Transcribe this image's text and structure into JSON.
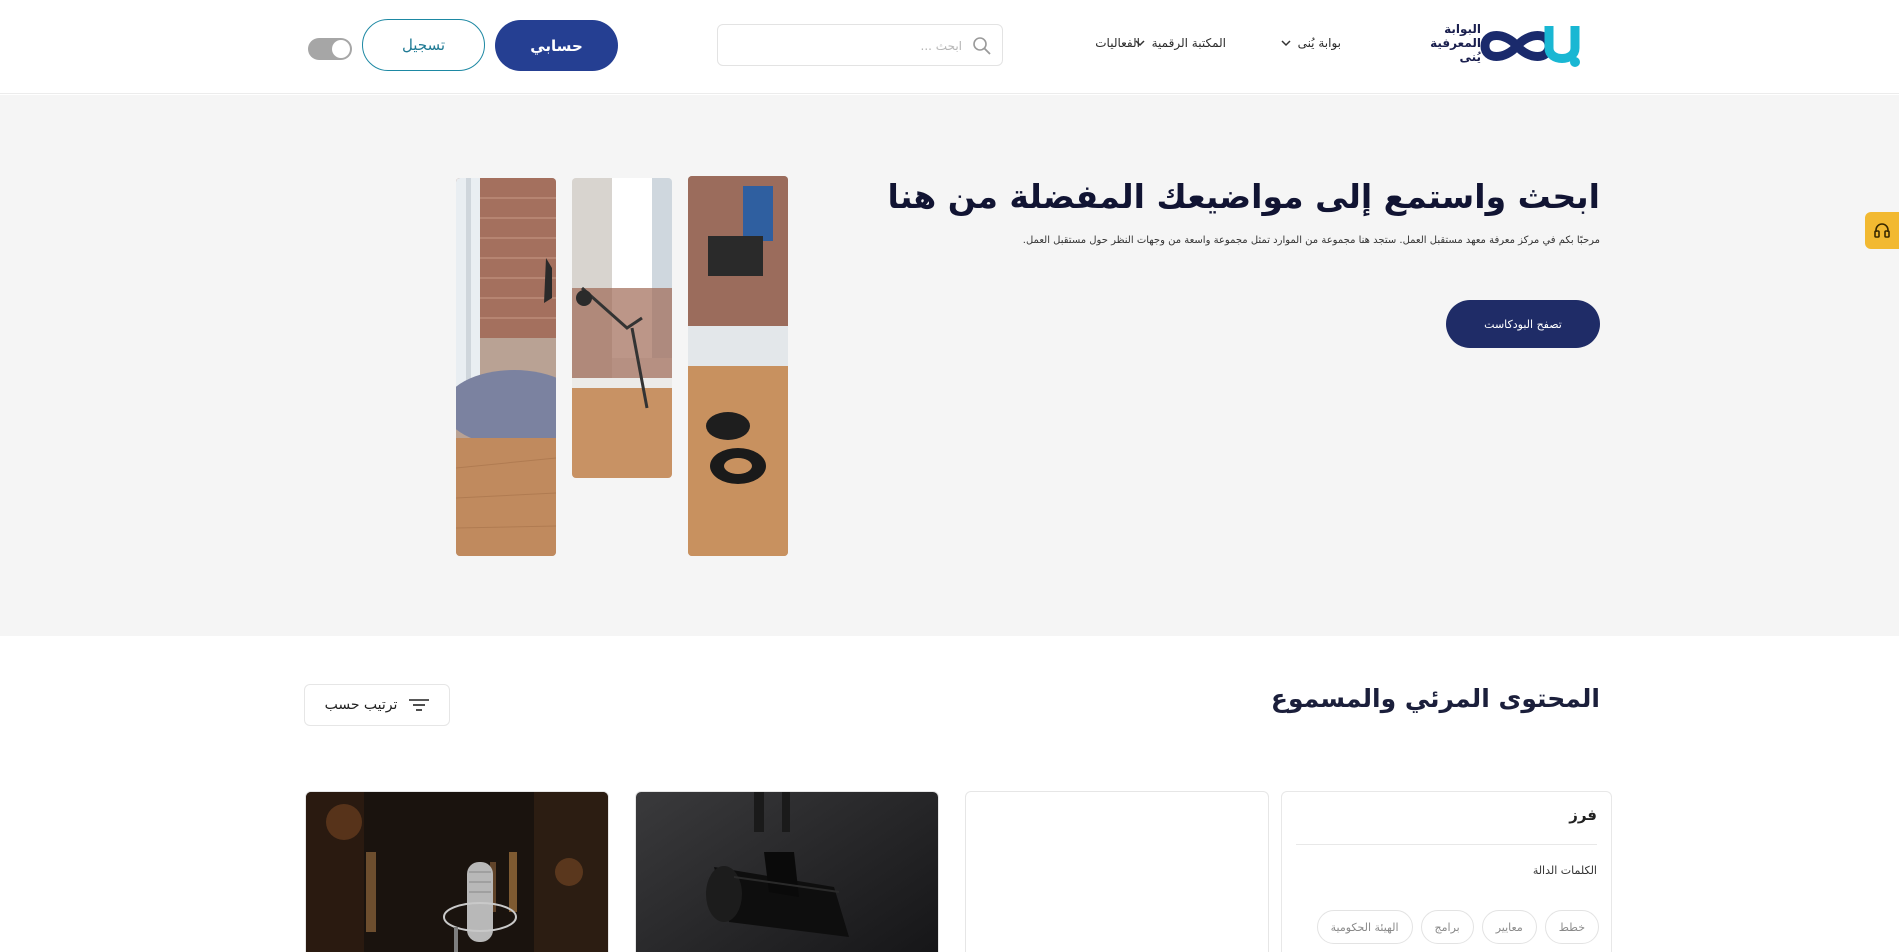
{
  "header": {
    "logo_text": "البوابة المعرفية يُنى",
    "nav": [
      {
        "label": "بوابة يُنى",
        "has_dropdown": true
      },
      {
        "label": "المكتبة الرقمية",
        "has_dropdown": true
      },
      {
        "label": "الفعاليات",
        "has_dropdown": false
      }
    ],
    "search_placeholder": "ابحث ...",
    "account_label": "حسابي",
    "register_label": "تسجيل",
    "toggle_on": false
  },
  "hero": {
    "title": "ابحث واستمع إلى مواضيعك المفضلة من هنا",
    "subtitle": "مرحبًا بكم في مركز معرفة معهد مستقبل العمل. ستجد هنا مجموعة من الموارد تمثل مجموعة واسعة من وجهات النظر حول مستقبل العمل.",
    "browse_label": "تصفح البودكاست"
  },
  "content": {
    "section_title": "المحتوى المرئي والمسموع",
    "sort_label": "ترتيب حسب"
  },
  "filter": {
    "title": "فرز",
    "keywords_label": "الكلمات الدالة",
    "chips": [
      "خطط",
      "معايير",
      "برامج",
      "الهيئة الحكومية"
    ]
  },
  "colors": {
    "primary": "#253f92",
    "navy": "#1f2c67",
    "teal": "#1d88a3",
    "accent_yellow": "#f2b931",
    "hero_bg": "#f5f5f5"
  }
}
